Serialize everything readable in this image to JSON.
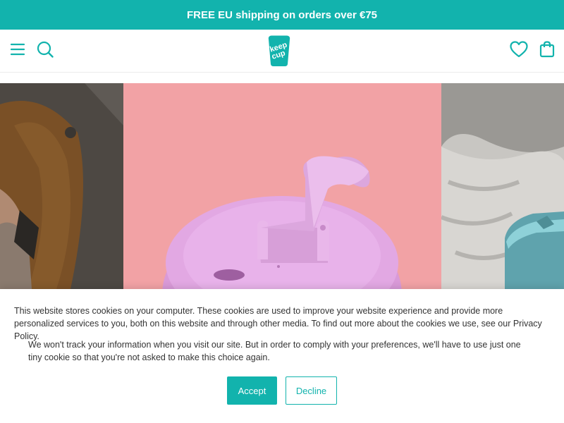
{
  "promo": {
    "text": "FREE EU shipping on orders over €75"
  },
  "header": {
    "menu_icon": "hamburger-menu-icon",
    "search_icon": "search-icon",
    "logo_text": "keep cup",
    "wishlist_icon": "heart-icon",
    "cart_icon": "shopping-bag-icon"
  },
  "colors": {
    "brand": "#12b3ad",
    "accent_text": "#12b3ad"
  },
  "cookie_banner": {
    "message": "This website stores cookies on your computer. These cookies are used to improve your website experience and provide more personalized services to you, both on this website and through other media. To find out more about the cookies we use, see our Privacy Policy.",
    "tracking_note": "We won't track your information when you visit our site. But in order to comply with your preferences, we'll have to use just one tiny cookie so that you're not asked to make this choice again.",
    "accept_label": "Accept",
    "decline_label": "Decline"
  }
}
